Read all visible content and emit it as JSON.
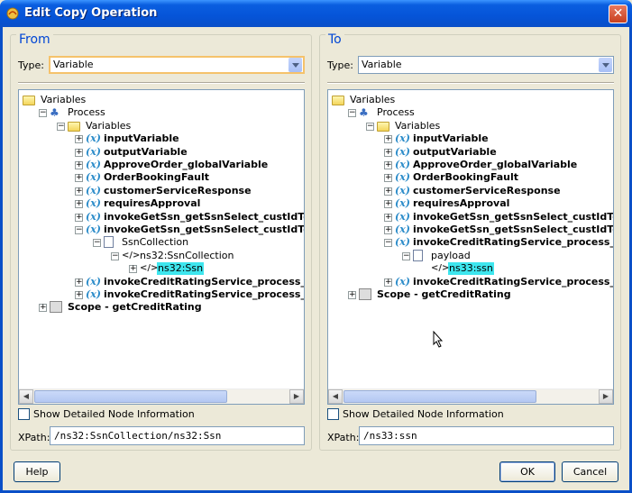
{
  "window": {
    "title": "Edit Copy Operation"
  },
  "from": {
    "title": "From",
    "type_label": "Type:",
    "type_value": "Variable",
    "tree": [
      {
        "label": "Variables",
        "icon": "folder-icon",
        "level": 0,
        "expander": "none",
        "bold": false
      },
      {
        "label": "Process",
        "icon": "process-icon",
        "level": 1,
        "expander": "minus",
        "bold": false
      },
      {
        "label": "Variables",
        "icon": "folder-icon",
        "level": 2,
        "expander": "minus",
        "bold": false
      },
      {
        "label": "inputVariable",
        "icon": "variable-icon",
        "level": 3,
        "expander": "plus",
        "bold": true
      },
      {
        "label": "outputVariable",
        "icon": "variable-icon",
        "level": 3,
        "expander": "plus",
        "bold": true
      },
      {
        "label": "ApproveOrder_globalVariable",
        "icon": "variable-icon",
        "level": 3,
        "expander": "plus",
        "bold": true
      },
      {
        "label": "OrderBookingFault",
        "icon": "variable-icon",
        "level": 3,
        "expander": "plus",
        "bold": true
      },
      {
        "label": "customerServiceResponse",
        "icon": "variable-icon",
        "level": 3,
        "expander": "plus",
        "bold": true
      },
      {
        "label": "requiresApproval",
        "icon": "variable-icon",
        "level": 3,
        "expander": "plus",
        "bold": true
      },
      {
        "label": "invokeGetSsn_getSsnSelect_custIdToGet",
        "icon": "variable-icon",
        "level": 3,
        "expander": "plus",
        "bold": true
      },
      {
        "label": "invokeGetSsn_getSsnSelect_custIdToGet",
        "icon": "variable-icon",
        "level": 3,
        "expander": "minus",
        "bold": true
      },
      {
        "label": "SsnCollection",
        "icon": "part-icon",
        "level": 4,
        "expander": "minus",
        "bold": false
      },
      {
        "label": "ns32:SsnCollection",
        "icon": "element-icon",
        "level": 5,
        "expander": "minus",
        "bold": false
      },
      {
        "label": "ns32:Ssn",
        "icon": "element-icon",
        "level": 6,
        "expander": "plus",
        "bold": false,
        "selected": true
      },
      {
        "label": "invokeCreditRatingService_process_Input",
        "icon": "variable-icon",
        "level": 3,
        "expander": "plus",
        "bold": true
      },
      {
        "label": "invokeCreditRatingService_process_Output",
        "icon": "variable-icon",
        "level": 3,
        "expander": "plus",
        "bold": true
      },
      {
        "label": "Scope - getCreditRating",
        "icon": "scope-icon",
        "level": 1,
        "expander": "plus",
        "bold": true
      }
    ],
    "show_detail_label": "Show Detailed Node Information",
    "xpath_label": "XPath:",
    "xpath_value": "/ns32:SsnCollection/ns32:Ssn"
  },
  "to": {
    "title": "To",
    "type_label": "Type:",
    "type_value": "Variable",
    "tree": [
      {
        "label": "Variables",
        "icon": "folder-icon",
        "level": 0,
        "expander": "none",
        "bold": false
      },
      {
        "label": "Process",
        "icon": "process-icon",
        "level": 1,
        "expander": "minus",
        "bold": false
      },
      {
        "label": "Variables",
        "icon": "folder-icon",
        "level": 2,
        "expander": "minus",
        "bold": false
      },
      {
        "label": "inputVariable",
        "icon": "variable-icon",
        "level": 3,
        "expander": "plus",
        "bold": true
      },
      {
        "label": "outputVariable",
        "icon": "variable-icon",
        "level": 3,
        "expander": "plus",
        "bold": true
      },
      {
        "label": "ApproveOrder_globalVariable",
        "icon": "variable-icon",
        "level": 3,
        "expander": "plus",
        "bold": true
      },
      {
        "label": "OrderBookingFault",
        "icon": "variable-icon",
        "level": 3,
        "expander": "plus",
        "bold": true
      },
      {
        "label": "customerServiceResponse",
        "icon": "variable-icon",
        "level": 3,
        "expander": "plus",
        "bold": true
      },
      {
        "label": "requiresApproval",
        "icon": "variable-icon",
        "level": 3,
        "expander": "plus",
        "bold": true
      },
      {
        "label": "invokeGetSsn_getSsnSelect_custIdToGet",
        "icon": "variable-icon",
        "level": 3,
        "expander": "plus",
        "bold": true
      },
      {
        "label": "invokeGetSsn_getSsnSelect_custIdToGet",
        "icon": "variable-icon",
        "level": 3,
        "expander": "plus",
        "bold": true
      },
      {
        "label": "invokeCreditRatingService_process_Input",
        "icon": "variable-icon",
        "level": 3,
        "expander": "minus",
        "bold": true
      },
      {
        "label": "payload",
        "icon": "part-icon",
        "level": 4,
        "expander": "minus",
        "bold": false
      },
      {
        "label": "ns33:ssn",
        "icon": "element-icon",
        "level": 5,
        "expander": "none",
        "bold": false,
        "selected": true
      },
      {
        "label": "invokeCreditRatingService_process_Output",
        "icon": "variable-icon",
        "level": 3,
        "expander": "plus",
        "bold": true
      },
      {
        "label": "Scope - getCreditRating",
        "icon": "scope-icon",
        "level": 1,
        "expander": "plus",
        "bold": true
      }
    ],
    "show_detail_label": "Show Detailed Node Information",
    "xpath_label": "XPath:",
    "xpath_value": "/ns33:ssn"
  },
  "buttons": {
    "help": "Help",
    "ok": "OK",
    "cancel": "Cancel"
  },
  "colors": {
    "title_bar": "#0554d8",
    "selection": "#3ee6ee",
    "panel_title": "#0046d5",
    "dialog_bg": "#ece9d8"
  }
}
